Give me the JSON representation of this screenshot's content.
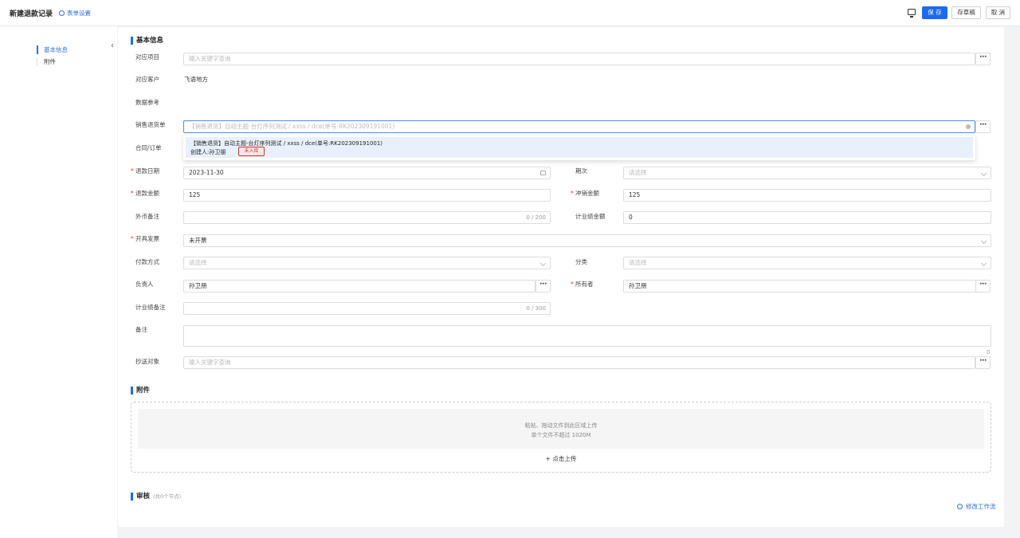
{
  "header": {
    "title": "新建退款记录",
    "form_settings": "表单设置",
    "save": "保 存",
    "draft": "存草稿",
    "cancel": "取 消"
  },
  "sidebar": {
    "items": [
      "基本信息",
      "附件"
    ]
  },
  "sections": {
    "basic": "基本信息",
    "attachment": "附件",
    "review": "审核",
    "review_sub": "(共0个节点)"
  },
  "fields": {
    "project": {
      "label": "对应项目",
      "placeholder": "输入关键字查询"
    },
    "customer": {
      "label": "对应客户",
      "value": "飞语地方"
    },
    "data_ref": {
      "label": "数据参考"
    },
    "sales_return": {
      "label": "销售退货单",
      "placeholder": "【销售退货】自动主题-台灯序列测试 / xxss / dce(单号:RK202309191001)"
    },
    "contract": {
      "label": "合同/订单"
    },
    "refund_date": {
      "label": "退款日期",
      "value": "2023-11-30"
    },
    "period": {
      "label": "期次",
      "placeholder": "请选择"
    },
    "refund_amount": {
      "label": "退款金额",
      "value": "125"
    },
    "offset_amount": {
      "label": "冲销金额",
      "value": "125"
    },
    "fx_note": {
      "label": "外币备注",
      "counter": "0 / 200"
    },
    "perf_amount": {
      "label": "计业绩金额",
      "value": "0"
    },
    "invoice": {
      "label": "开具发票",
      "value": "未开票"
    },
    "pay_method": {
      "label": "付款方式",
      "placeholder": "请选择"
    },
    "category": {
      "label": "分类",
      "placeholder": "请选择"
    },
    "owner_resp": {
      "label": "负责人",
      "value": "孙卫朋"
    },
    "owner": {
      "label": "所有者",
      "value": "孙卫朋"
    },
    "perf_note": {
      "label": "计业绩备注",
      "counter": "0 / 300"
    },
    "remark": {
      "label": "备注",
      "counter": "0"
    },
    "cc": {
      "label": "抄送对象",
      "placeholder": "输入关键字查询"
    }
  },
  "dropdown": {
    "line1": "【销售退货】自动主题-台灯序列测试 / xxss / dce(单号:RK202309191001)",
    "line2": "创建人:孙卫朋",
    "badge": "未入库"
  },
  "upload": {
    "line1": "粘贴、拖动文件到此区域上传",
    "line2": "单个文件不超过 1020M",
    "button": "+ 点击上传"
  },
  "workflow": {
    "modify": "修改工作流"
  },
  "more_label": "···"
}
